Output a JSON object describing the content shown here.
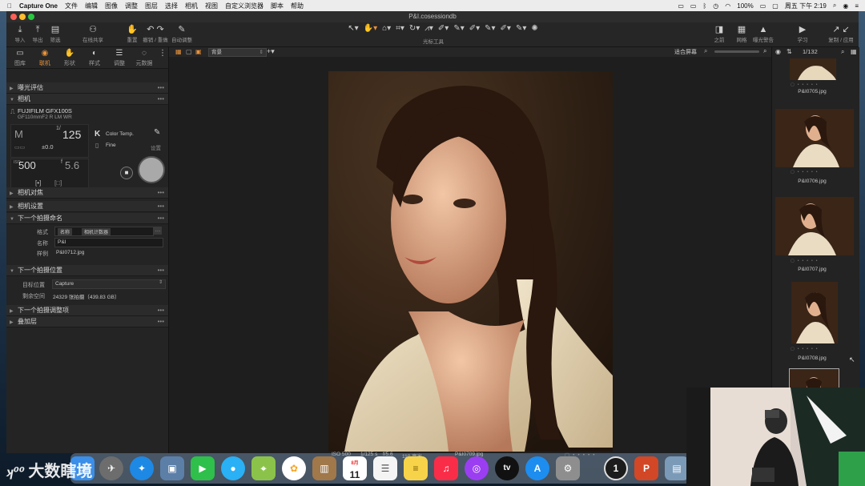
{
  "menubar": {
    "apple_icon": "apple-icon",
    "app_name": "Capture One",
    "items": [
      "文件",
      "编辑",
      "图像",
      "调整",
      "图层",
      "选择",
      "相机",
      "视图",
      "自定义浏览器",
      "脚本",
      "帮助"
    ],
    "battery": "100%",
    "datetime": "周五 下午 2:19"
  },
  "window": {
    "title": "P&I.cosessiondb"
  },
  "toolbar": {
    "left": [
      {
        "label": "导入",
        "icon": "import-icon"
      },
      {
        "label": "导出",
        "icon": "export-icon"
      },
      {
        "label": "筛选",
        "icon": "filter-icon"
      },
      {
        "label": "在线共享",
        "icon": "share-icon"
      },
      {
        "label": "重置",
        "icon": "reset-icon"
      },
      {
        "label": "撤销 / 重做",
        "icon": "undo-redo-icon"
      },
      {
        "label": "自动调整",
        "icon": "auto-adjust-icon"
      }
    ],
    "center_label": "光标工具",
    "right": [
      {
        "label": "之前",
        "icon": "before-icon"
      },
      {
        "label": "网格",
        "icon": "grid-icon"
      },
      {
        "label": "曝光警告",
        "icon": "exposure-warning-icon"
      },
      {
        "label": "学习",
        "icon": "learn-icon"
      },
      {
        "label": "复制 / 应用",
        "icon": "copy-apply-icon"
      }
    ]
  },
  "tabs": [
    {
      "label": "图库",
      "icon": "library-icon"
    },
    {
      "label": "联机",
      "icon": "capture-icon",
      "active": true
    },
    {
      "label": "形状",
      "icon": "shape-icon"
    },
    {
      "label": "样式",
      "icon": "style-icon"
    },
    {
      "label": "调整",
      "icon": "adjust-icon"
    },
    {
      "label": "元数据",
      "icon": "metadata-icon"
    }
  ],
  "panel": {
    "section_exposure_eval": "曝光评估",
    "section_camera": "相机",
    "camera_model": "FUJIFILM GFX100S",
    "lens": "GF110mmF2 R LM WR",
    "mode": "M",
    "shutter": "125",
    "shutter_prefix": "1/",
    "ev": "±0.0",
    "iso_prefix": "ISO",
    "iso": "500",
    "aperture_prefix": "f",
    "aperture": "5.6",
    "wb_label": "Color Temp.",
    "quality": "Fine",
    "settings_label": "设置",
    "section_focus": "相机对焦",
    "section_camera_settings": "相机设置",
    "section_next_naming": "下一个拍摄命名",
    "format_label": "格式",
    "format_token1": "名称",
    "format_token2": "相机计数器",
    "name_label": "名称",
    "name_value": "P&I",
    "sample_label": "样例",
    "sample_value": "P&I0712.jpg",
    "section_next_location": "下一个拍摄位置",
    "dest_label": "目标位置",
    "dest_value": "Capture",
    "remaining_label": "剩余空间",
    "remaining_value": "24329 张拍摄（439.83 GB）",
    "section_next_adjust": "下一个拍摄调整项",
    "section_overlay": "叠加层"
  },
  "viewer": {
    "view_select": "背景",
    "fit_label": "适合屏幕",
    "counter": "1/132",
    "footer": {
      "iso": "ISO 500",
      "shutter": "1/125 s",
      "aperture": "f/5.6",
      "focal": "110 毫米",
      "filename": "P&I0709.jpg"
    }
  },
  "browser": {
    "thumbnails": [
      "P&I0705.jpg",
      "P&I0706.jpg",
      "P&I0707.jpg",
      "P&I0708.jpg"
    ]
  },
  "dock": {
    "apps": [
      {
        "name": "finder-icon",
        "color": "#3b8fe8"
      },
      {
        "name": "launchpad-icon",
        "color": "#6d6d6d"
      },
      {
        "name": "safari-icon",
        "color": "#1e88e5"
      },
      {
        "name": "preview-icon",
        "color": "#5c7fa8"
      },
      {
        "name": "facetime-icon",
        "color": "#2ec04a"
      },
      {
        "name": "messages-icon",
        "color": "#29b0f5"
      },
      {
        "name": "maps-icon",
        "color": "#8bc34a"
      },
      {
        "name": "photos-icon",
        "color": "#f6a623"
      },
      {
        "name": "contacts-icon",
        "color": "#a0784a"
      },
      {
        "name": "calendar-icon",
        "color": "#ffffff"
      },
      {
        "name": "reminders-icon",
        "color": "#f4f4f4"
      },
      {
        "name": "notes-icon",
        "color": "#f7d34a"
      },
      {
        "name": "music-icon",
        "color": "#fa2d48"
      },
      {
        "name": "podcasts-icon",
        "color": "#9b3ef2"
      },
      {
        "name": "tv-icon",
        "color": "#111111"
      },
      {
        "name": "app-store-icon",
        "color": "#1d8df0"
      },
      {
        "name": "system-preferences-icon",
        "color": "#8e8e8e"
      },
      {
        "name": "capture-one-icon",
        "color": "#1c1c1c"
      },
      {
        "name": "powerpoint-icon",
        "color": "#d24726"
      },
      {
        "name": "image-viewer-icon",
        "color": "#7a9ab8"
      }
    ],
    "calendar_month": "8月",
    "calendar_day": "11",
    "tv_label": "tv",
    "capture_one_label": "1",
    "powerpoint_label": "P"
  },
  "watermark": "大数瞎境",
  "colors": {
    "accent": "#e8923a",
    "panel_bg": "#242424",
    "viewer_bg": "#1e1e1e"
  }
}
